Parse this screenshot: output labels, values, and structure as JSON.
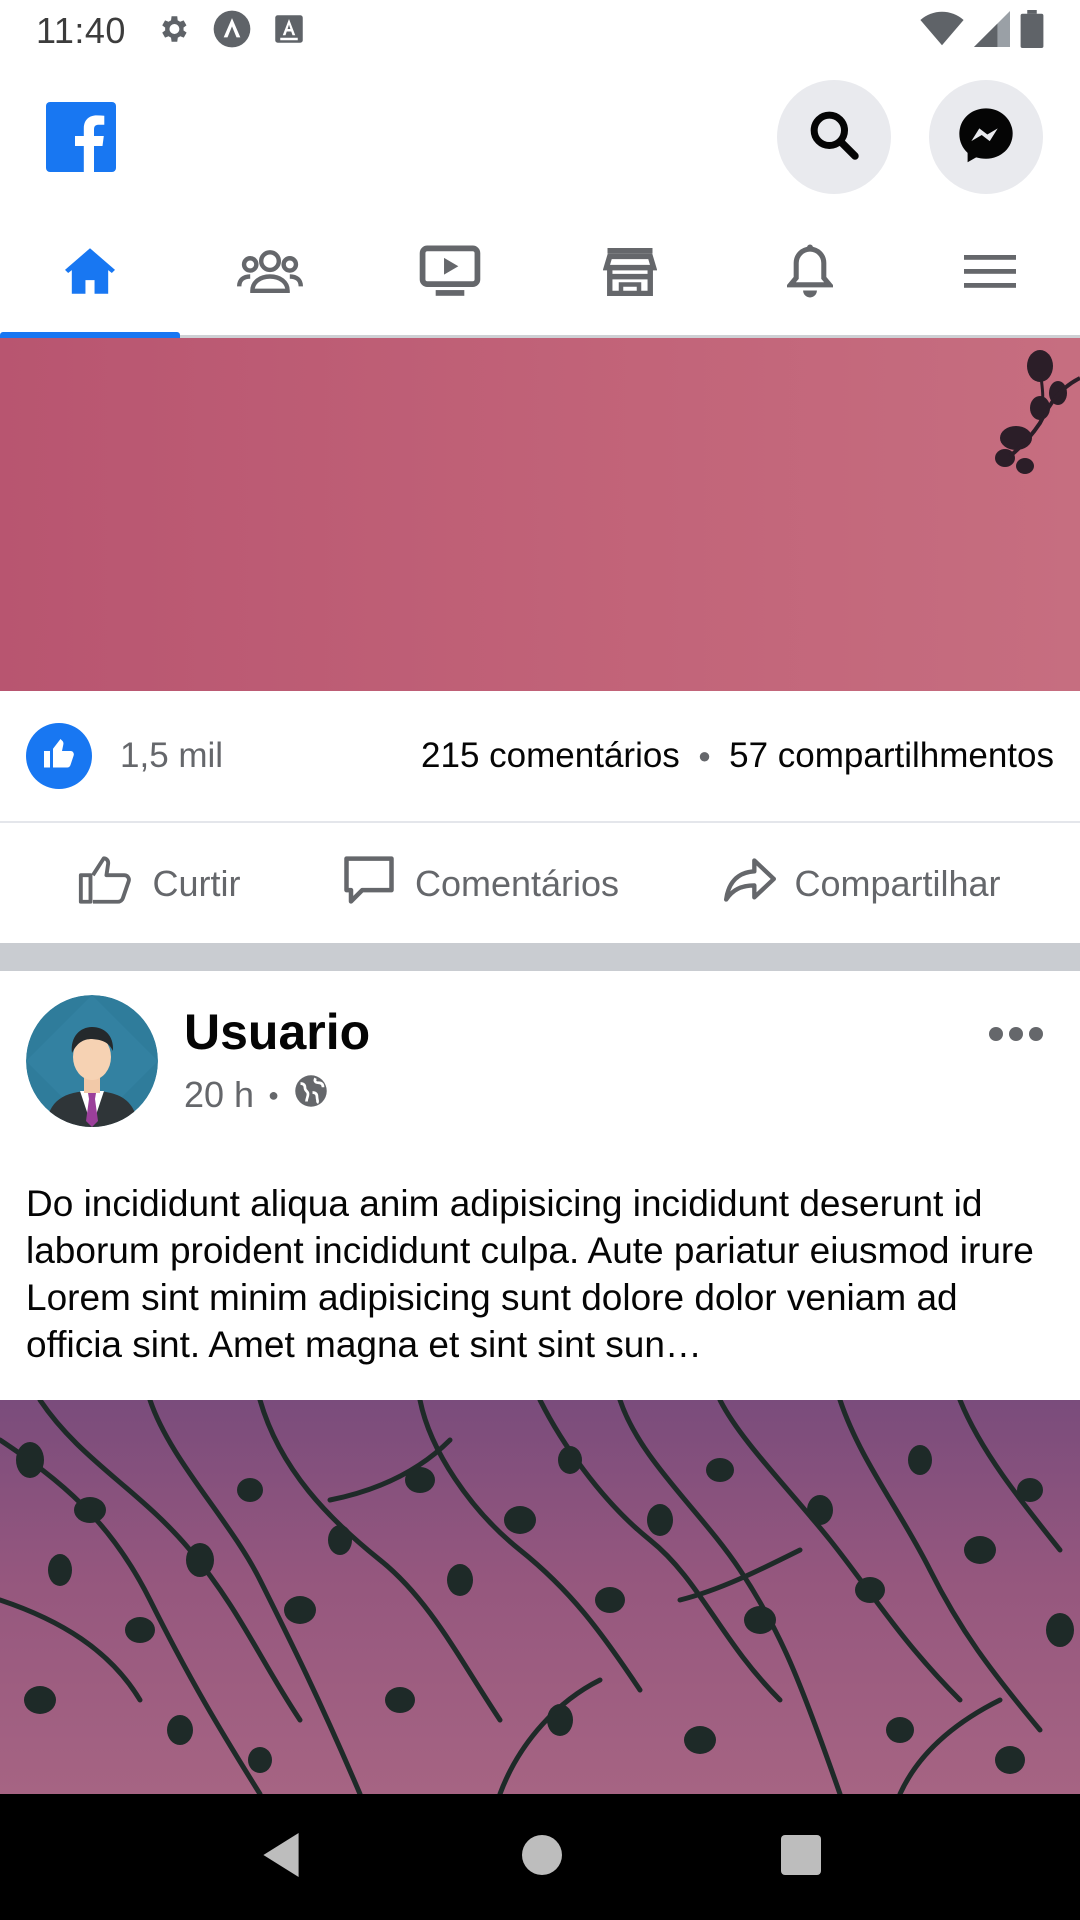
{
  "status_bar": {
    "time": "11:40",
    "left_icons": [
      "gear-icon",
      "vpn-a-icon",
      "font-a-icon"
    ],
    "right_icons": [
      "wifi-icon",
      "signal-icon",
      "battery-icon"
    ]
  },
  "header": {
    "logo": "facebook-logo",
    "actions": [
      "search-icon",
      "messenger-icon"
    ]
  },
  "tabs": [
    {
      "name": "home",
      "icon": "home-icon",
      "active": true
    },
    {
      "name": "friends",
      "icon": "friends-icon",
      "active": false
    },
    {
      "name": "watch",
      "icon": "watch-icon",
      "active": false
    },
    {
      "name": "marketplace",
      "icon": "store-icon",
      "active": false
    },
    {
      "name": "notifications",
      "icon": "bell-icon",
      "active": false
    },
    {
      "name": "menu",
      "icon": "hamburger-icon",
      "active": false
    }
  ],
  "first_post": {
    "reactions_count": "1,5 mil",
    "comments": "215 comentários",
    "shares": "57 compartilhmentos",
    "actions": {
      "like": "Curtir",
      "comment": "Comentários",
      "share": "Compartilhar"
    }
  },
  "post": {
    "author": "Usuario",
    "time": "20 h",
    "text": "Do incididunt aliqua anim adipisicing incididunt deserunt id laborum proident incididunt culpa. Aute pariatur eiusmod irure Lorem sint minim adipisicing sunt dolore dolor veniam ad officia sint. Amet magna et sint sint sun…"
  },
  "colors": {
    "brand": "#1877f2",
    "secondary_text": "#65676b",
    "divider": "#c9ccd1"
  }
}
